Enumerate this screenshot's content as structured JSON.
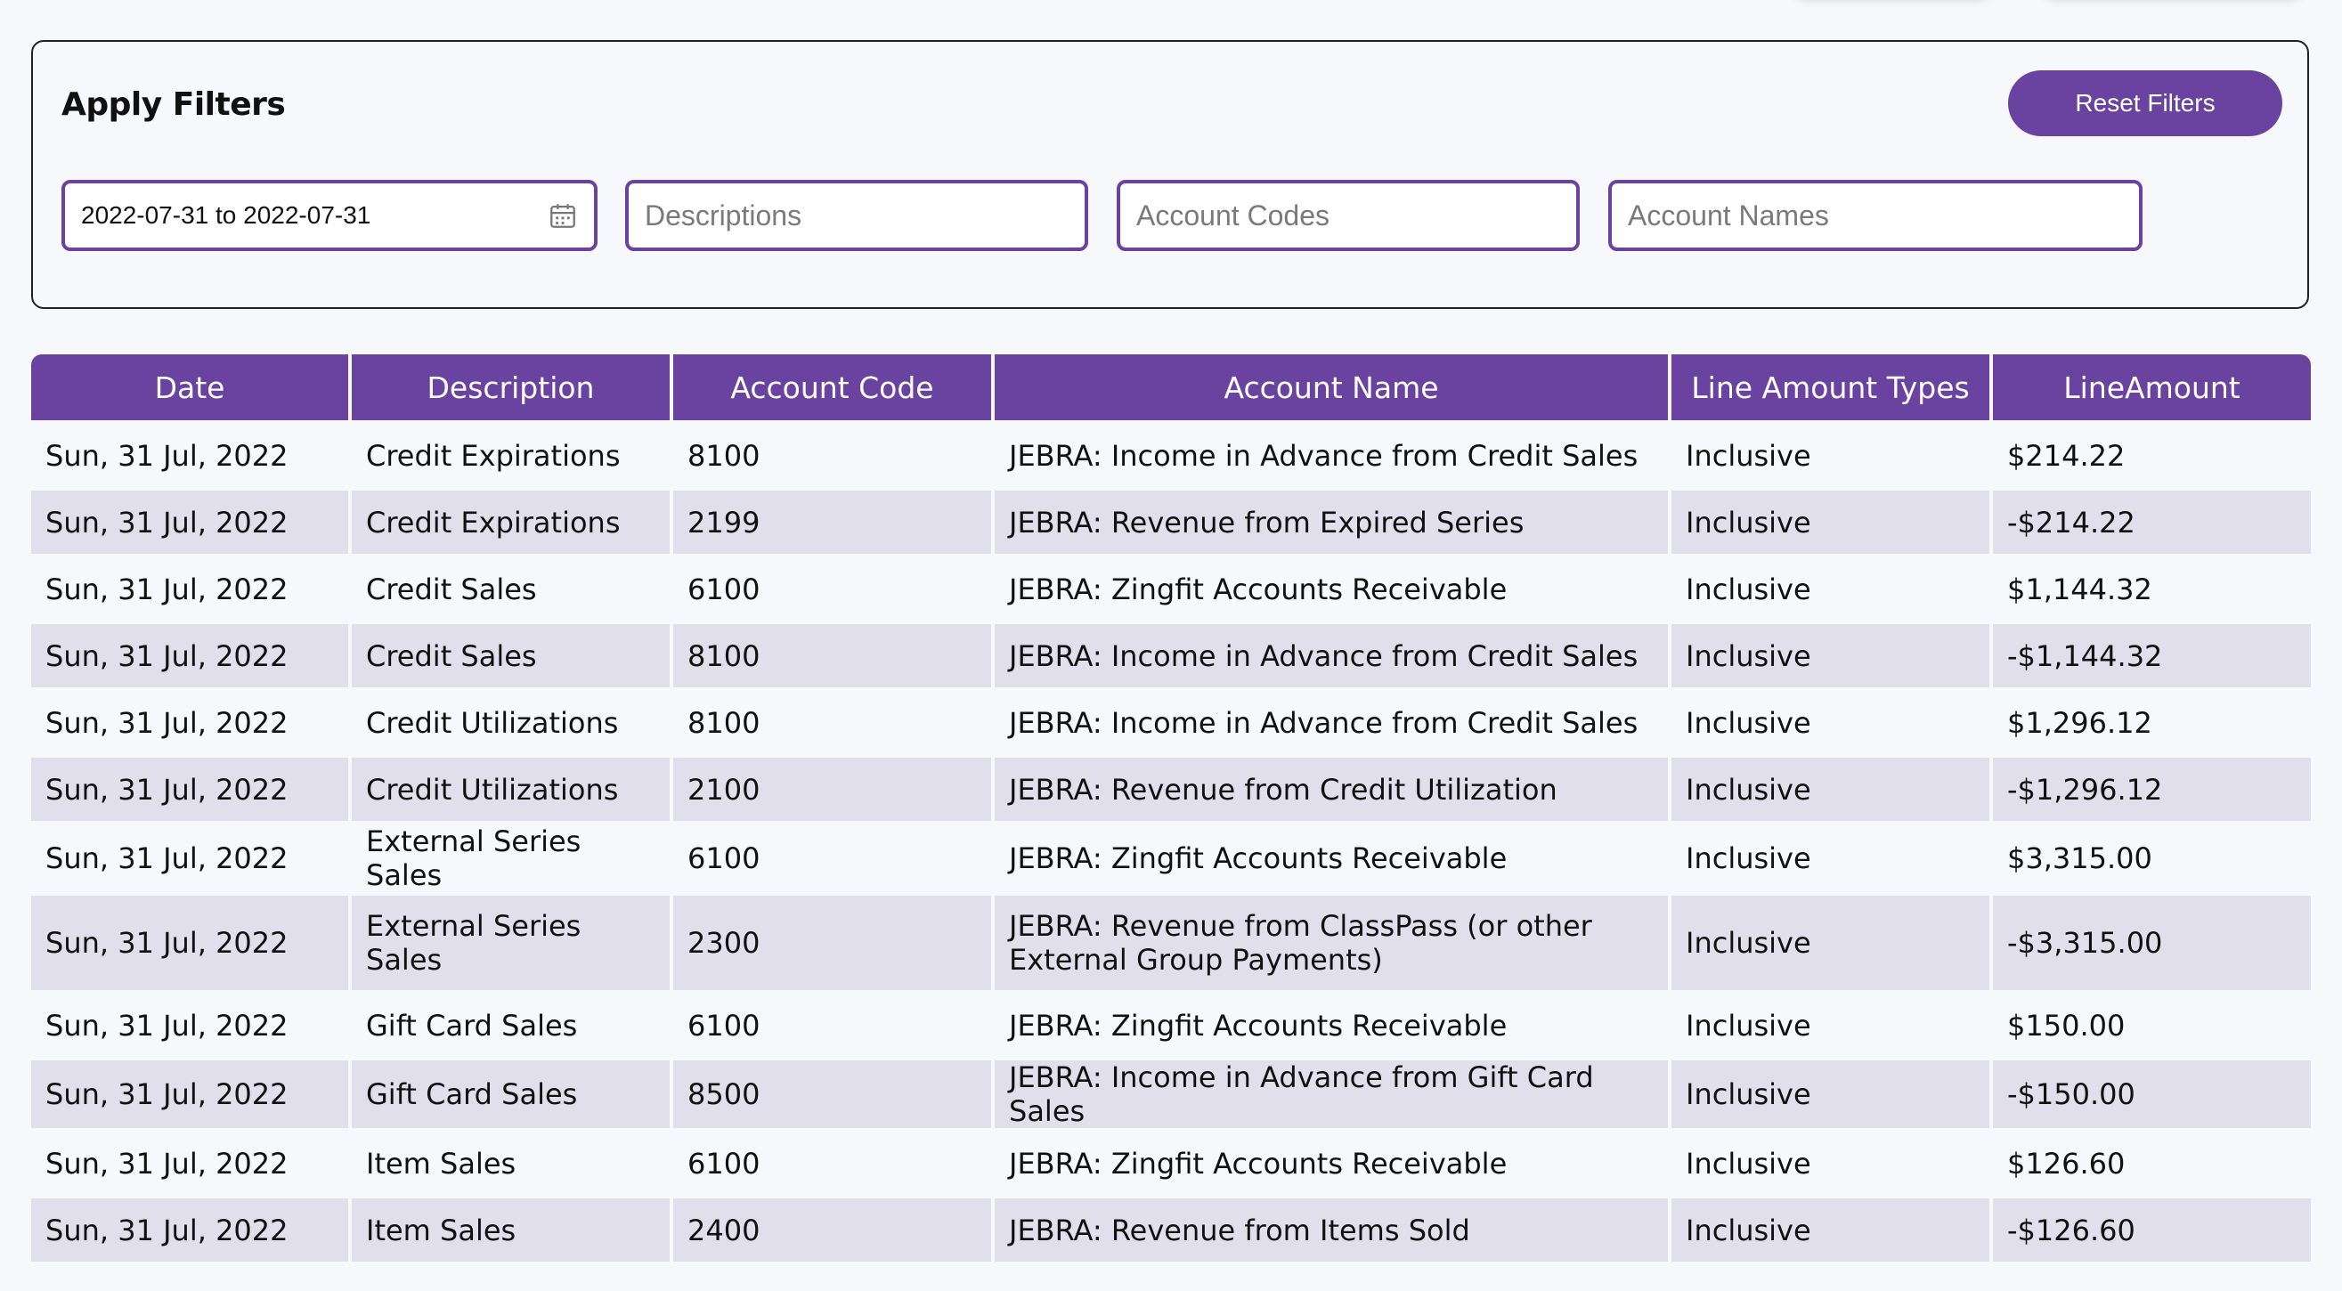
{
  "filters": {
    "title": "Apply Filters",
    "reset_label": "Reset Filters",
    "date_range": "2022-07-31 to 2022-07-31",
    "descriptions_placeholder": "Descriptions",
    "account_codes_placeholder": "Account Codes",
    "account_names_placeholder": "Account Names"
  },
  "table": {
    "headers": [
      "Date",
      "Description",
      "Account Code",
      "Account Name",
      "Line Amount Types",
      "LineAmount"
    ],
    "rows": [
      [
        "Sun, 31 Jul, 2022",
        "Credit Expirations",
        "8100",
        "JEBRA: Income in Advance from Credit Sales",
        "Inclusive",
        "$214.22"
      ],
      [
        "Sun, 31 Jul, 2022",
        "Credit Expirations",
        "2199",
        "JEBRA: Revenue from Expired Series",
        "Inclusive",
        "-$214.22"
      ],
      [
        "Sun, 31 Jul, 2022",
        "Credit Sales",
        "6100",
        "JEBRA: Zingfit Accounts Receivable",
        "Inclusive",
        "$1,144.32"
      ],
      [
        "Sun, 31 Jul, 2022",
        "Credit Sales",
        "8100",
        "JEBRA: Income in Advance from Credit Sales",
        "Inclusive",
        "-$1,144.32"
      ],
      [
        "Sun, 31 Jul, 2022",
        "Credit Utilizations",
        "8100",
        "JEBRA: Income in Advance from Credit Sales",
        "Inclusive",
        "$1,296.12"
      ],
      [
        "Sun, 31 Jul, 2022",
        "Credit Utilizations",
        "2100",
        "JEBRA: Revenue from Credit Utilization",
        "Inclusive",
        "-$1,296.12"
      ],
      [
        "Sun, 31 Jul, 2022",
        "External Series Sales",
        "6100",
        "JEBRA: Zingfit Accounts Receivable",
        "Inclusive",
        "$3,315.00"
      ],
      [
        "Sun, 31 Jul, 2022",
        "External Series Sales",
        "2300",
        "JEBRA: Revenue from ClassPass (or other External Group Payments)",
        "Inclusive",
        "-$3,315.00"
      ],
      [
        "Sun, 31 Jul, 2022",
        "Gift Card Sales",
        "6100",
        "JEBRA: Zingfit Accounts Receivable",
        "Inclusive",
        "$150.00"
      ],
      [
        "Sun, 31 Jul, 2022",
        "Gift Card Sales",
        "8500",
        "JEBRA: Income in Advance from Gift Card Sales",
        "Inclusive",
        "-$150.00"
      ],
      [
        "Sun, 31 Jul, 2022",
        "Item Sales",
        "6100",
        "JEBRA: Zingfit Accounts Receivable",
        "Inclusive",
        "$126.60"
      ],
      [
        "Sun, 31 Jul, 2022",
        "Item Sales",
        "2400",
        "JEBRA: Revenue from Items Sold",
        "Inclusive",
        "-$126.60"
      ]
    ]
  },
  "colors": {
    "accent": "#6a43a0",
    "row_alt": "#e2dfed",
    "background": "#f6f8fc"
  }
}
